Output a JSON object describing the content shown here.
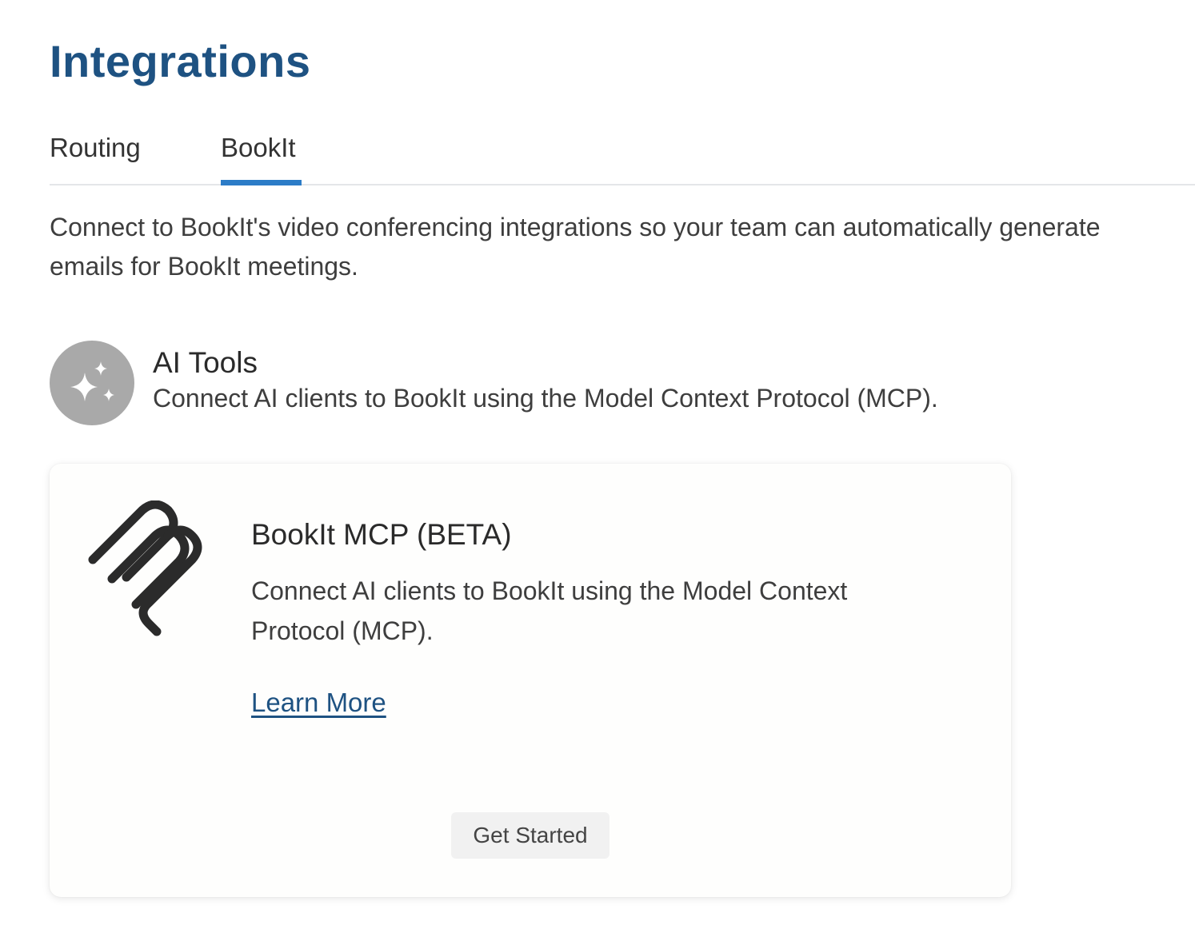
{
  "page": {
    "title": "Integrations"
  },
  "tabs": [
    {
      "label": "Routing",
      "active": false
    },
    {
      "label": "BookIt",
      "active": true
    }
  ],
  "intro": {
    "line1": "Connect to BookIt's video conferencing integrations so your team can automatically generate",
    "line2": "emails for BookIt meetings."
  },
  "section": {
    "icon": "sparkles-icon",
    "title": "AI Tools",
    "subtitle": "Connect AI clients to BookIt using the Model Context Protocol (MCP)."
  },
  "card": {
    "logo": "mcp-logo-icon",
    "title": "BookIt MCP (BETA)",
    "description": "Connect AI clients to BookIt using the Model Context Protocol (MCP).",
    "link_label": "Learn More",
    "button_label": "Get Started"
  },
  "colors": {
    "title": "#1e5282",
    "tab_accent": "#2c7cc7",
    "link": "#1e5282",
    "icon_circle": "#a9a9a9",
    "button_bg": "#f1f1f1"
  }
}
